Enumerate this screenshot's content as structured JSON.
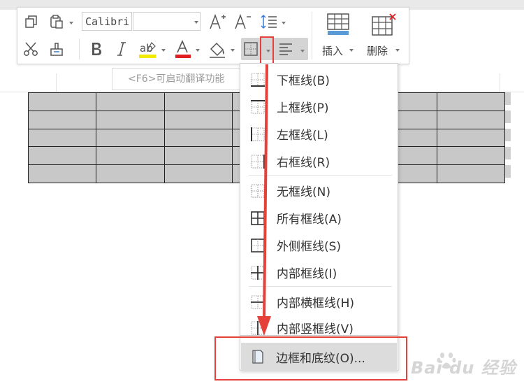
{
  "toolbar": {
    "font_name": "Calibri",
    "font_size": "",
    "insert_label": "插入",
    "delete_label": "删除"
  },
  "translate_hint": "<F6>可启动翻译功能",
  "table": {
    "rows": 5,
    "cols": 7
  },
  "border_menu": {
    "items": [
      {
        "label": "下框线(B)",
        "icon": "bottom-border-icon"
      },
      {
        "label": "上框线(P)",
        "icon": "top-border-icon"
      },
      {
        "label": "左框线(L)",
        "icon": "left-border-icon"
      },
      {
        "label": "右框线(R)",
        "icon": "right-border-icon"
      },
      {
        "label": "无框线(N)",
        "icon": "no-border-icon"
      },
      {
        "label": "所有框线(A)",
        "icon": "all-borders-icon"
      },
      {
        "label": "外侧框线(S)",
        "icon": "outside-borders-icon"
      },
      {
        "label": "内部框线(I)",
        "icon": "inside-borders-icon"
      },
      {
        "label": "内部横框线(H)",
        "icon": "inside-horizontal-border-icon"
      },
      {
        "label": "内部竖框线(V)",
        "icon": "inside-vertical-border-icon"
      },
      {
        "label": "边框和底纹(O)...",
        "icon": "borders-and-shading-icon"
      }
    ]
  },
  "annotation_color": "#e5403a",
  "watermark": {
    "text": "Bai du 经验"
  }
}
